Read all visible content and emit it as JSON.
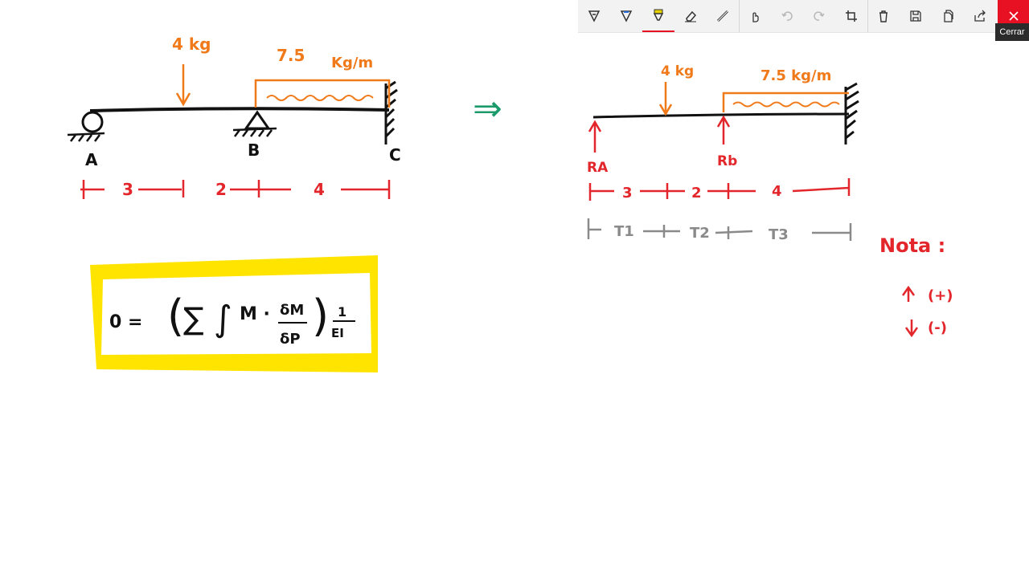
{
  "toolbar": {
    "tools": [
      {
        "name": "ballpoint-pen-icon"
      },
      {
        "name": "pencil-icon"
      },
      {
        "name": "highlighter-icon",
        "active": true,
        "color": "#e8d100"
      },
      {
        "name": "eraser-icon"
      },
      {
        "name": "ruler-icon"
      },
      {
        "name": "touch-writing-icon"
      },
      {
        "name": "undo-icon"
      },
      {
        "name": "redo-icon"
      },
      {
        "name": "crop-icon"
      },
      {
        "name": "delete-icon"
      },
      {
        "name": "save-icon"
      },
      {
        "name": "copy-icon"
      },
      {
        "name": "share-icon"
      },
      {
        "name": "close-icon"
      }
    ],
    "close_tooltip": "Cerrar",
    "accent_color": "#e81123"
  },
  "colors": {
    "ink_black": "#111111",
    "ink_orange": "#f07a1a",
    "ink_red": "#e3262b",
    "ink_green": "#1d9a6c",
    "ink_gray": "#8a8a8a",
    "highlight_yellow": "#ffe400"
  },
  "diagram_left": {
    "point_load": "4 kg",
    "dist_load_value": "7.5",
    "dist_load_unit": "Kg/m",
    "supports": [
      "A",
      "B",
      "C"
    ],
    "spans": [
      "3",
      "2",
      "4"
    ]
  },
  "arrow_symbol": "⇒",
  "diagram_right": {
    "point_load": "4 kg",
    "dist_load": "7.5 kg/m",
    "reactions": [
      "RA",
      "Rb"
    ],
    "spans": [
      "3",
      "2",
      "4"
    ],
    "segments": [
      "T1",
      "T2",
      "T3"
    ]
  },
  "formula": {
    "lhs": "0 =",
    "body": "(∑∫ M · δM/δP)",
    "numerator": "δM",
    "denominator": "δP",
    "factor_num": "1",
    "factor_den": "EI"
  },
  "nota": {
    "title": "Nota :",
    "up": "(+)",
    "down": "(-)"
  }
}
